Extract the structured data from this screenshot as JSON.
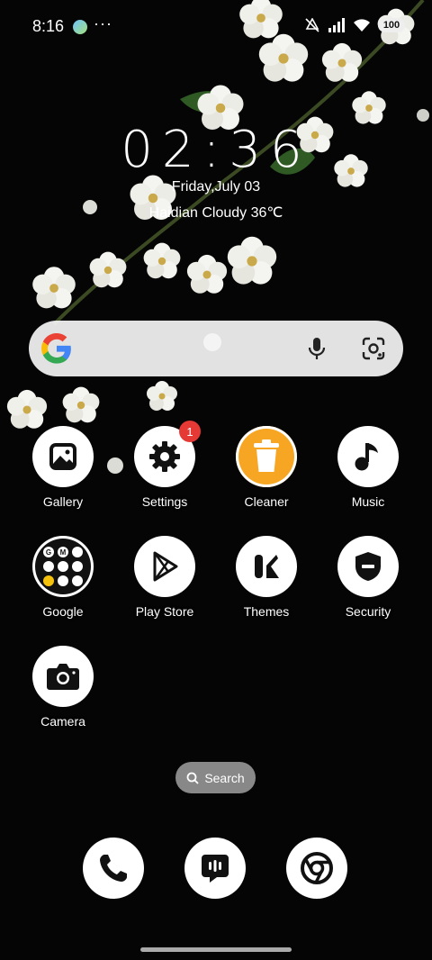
{
  "status_bar": {
    "time": "8:16",
    "more": "···",
    "battery": "100"
  },
  "clock_widget": {
    "time": "02:36",
    "date": "Friday,July 03",
    "weather": "Haidian Cloudy 36℃"
  },
  "search_bar": {
    "logo": "G",
    "mic_icon": "mic-icon",
    "lens_icon": "lens-icon"
  },
  "apps": [
    {
      "label": "Gallery",
      "icon": "gallery-icon"
    },
    {
      "label": "Settings",
      "icon": "gear-icon",
      "badge": "1"
    },
    {
      "label": "Cleaner",
      "icon": "trash-icon"
    },
    {
      "label": "Music",
      "icon": "music-note-icon"
    },
    {
      "label": "Google",
      "icon": "google-folder-icon"
    },
    {
      "label": "Play Store",
      "icon": "play-store-icon"
    },
    {
      "label": "Themes",
      "icon": "themes-icon"
    },
    {
      "label": "Security",
      "icon": "shield-icon"
    },
    {
      "label": "Camera",
      "icon": "camera-icon"
    }
  ],
  "search_pill": {
    "label": "Search"
  },
  "dock": [
    {
      "icon": "phone-icon"
    },
    {
      "icon": "messages-icon"
    },
    {
      "icon": "chrome-icon"
    }
  ],
  "colors": {
    "background": "#050505",
    "cleaner_accent": "#f6a623",
    "badge": "#e53935"
  }
}
